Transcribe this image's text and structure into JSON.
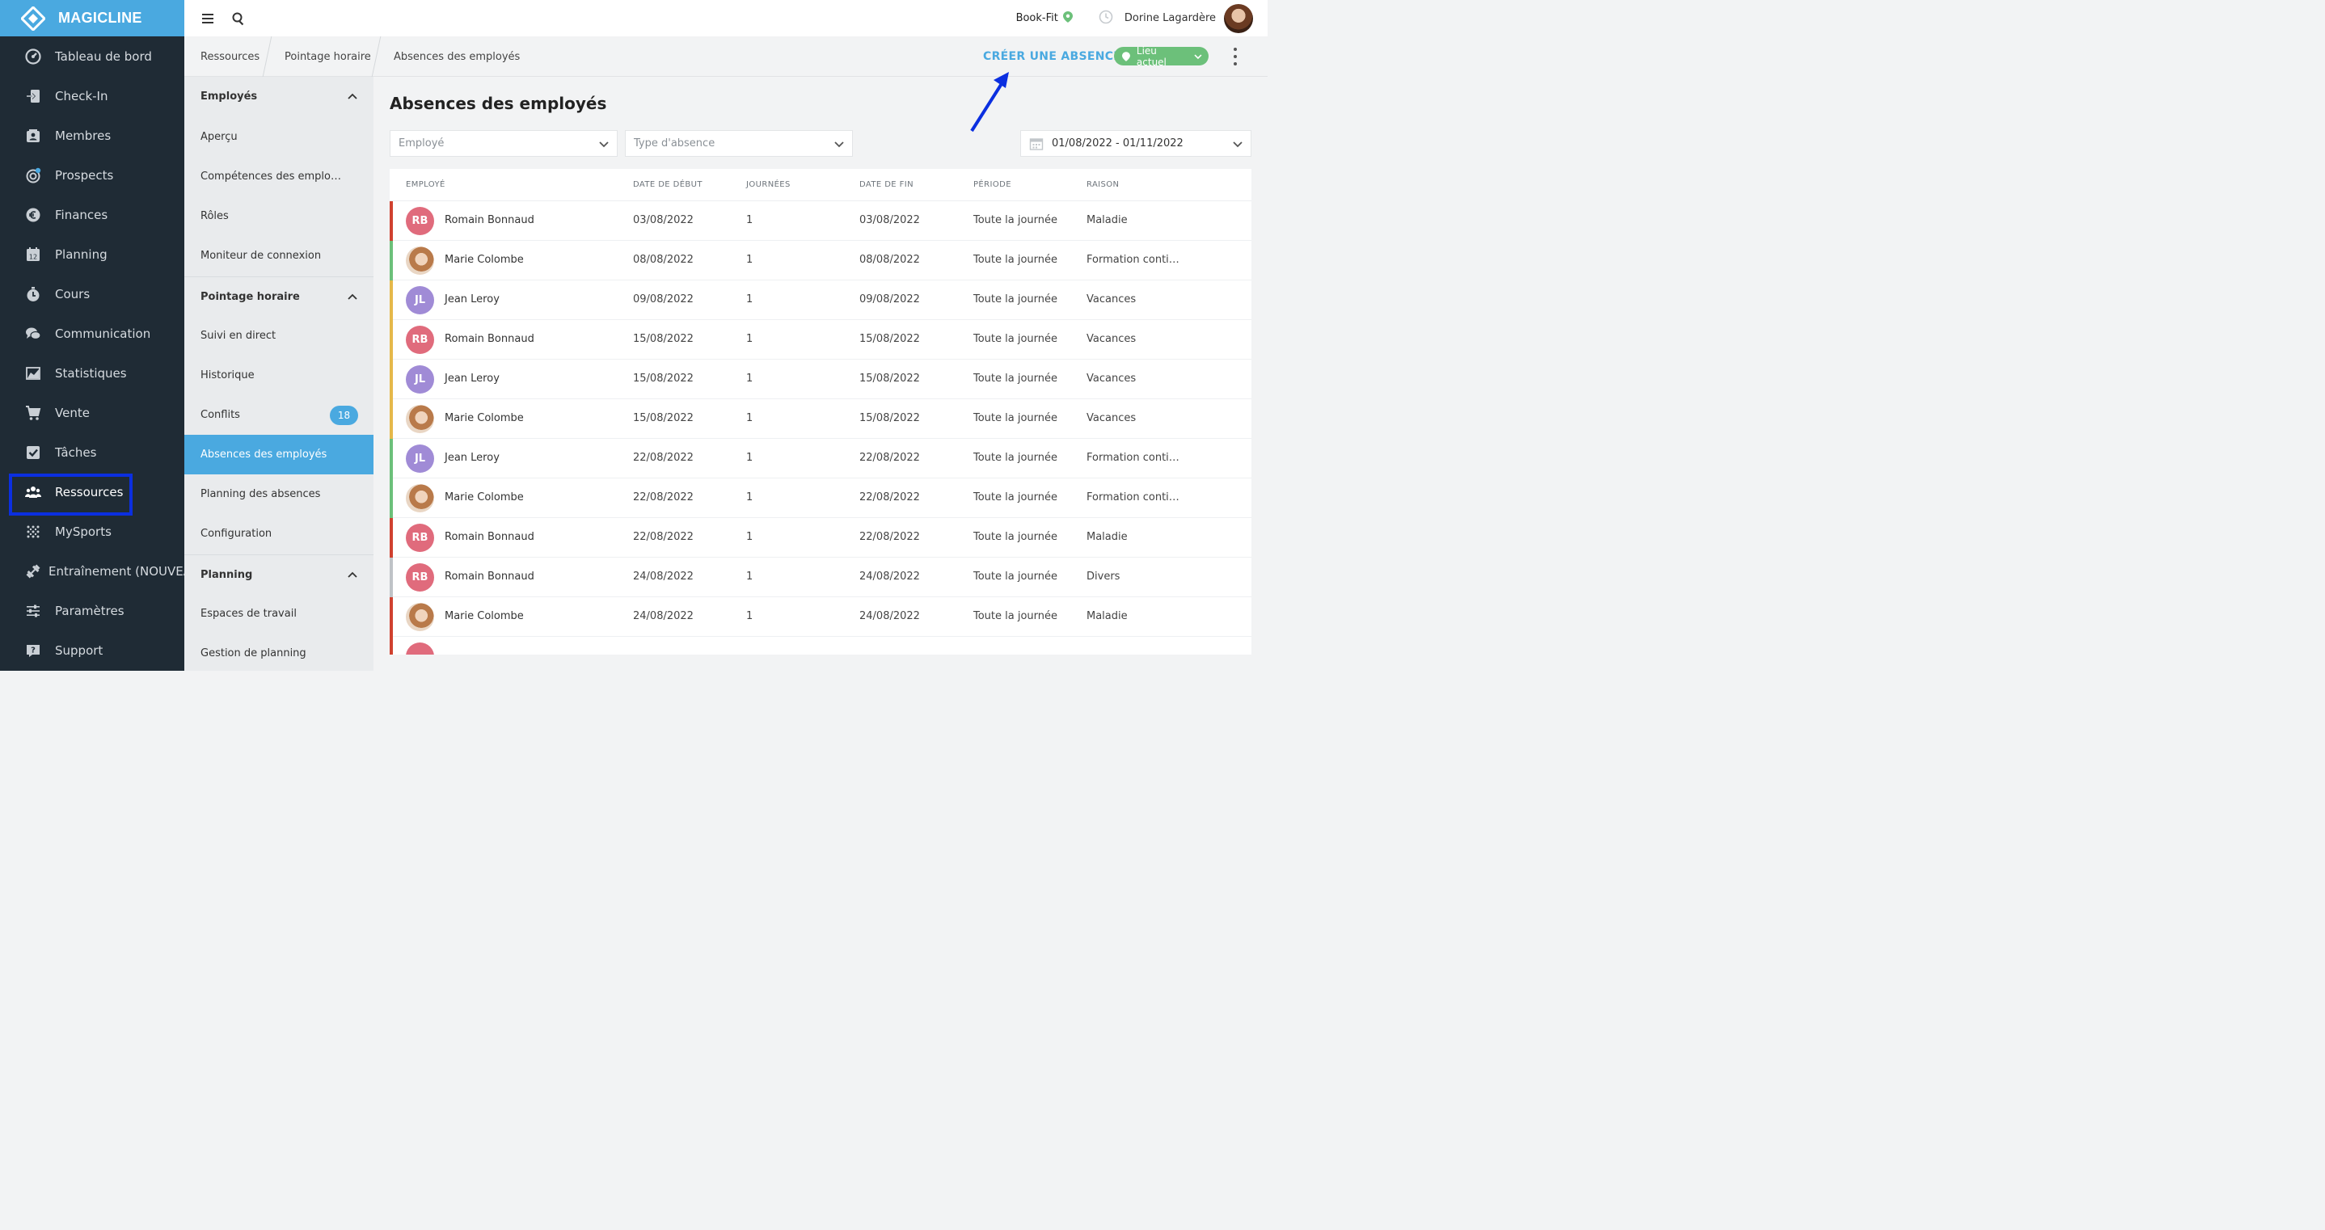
{
  "brand": {
    "name": "MAGICLINE"
  },
  "nav": {
    "items": [
      {
        "label": "Tableau de bord",
        "icon": "dashboard-icon"
      },
      {
        "label": "Check-In",
        "icon": "check-in-icon"
      },
      {
        "label": "Membres",
        "icon": "members-icon"
      },
      {
        "label": "Prospects",
        "icon": "prospects-icon"
      },
      {
        "label": "Finances",
        "icon": "euro-icon"
      },
      {
        "label": "Planning",
        "icon": "calendar-icon"
      },
      {
        "label": "Cours",
        "icon": "stopwatch-icon"
      },
      {
        "label": "Communication",
        "icon": "chat-icon"
      },
      {
        "label": "Statistiques",
        "icon": "chart-icon"
      },
      {
        "label": "Vente",
        "icon": "cart-icon"
      },
      {
        "label": "Tâches",
        "icon": "checkbox-icon"
      },
      {
        "label": "Ressources",
        "icon": "people-icon"
      },
      {
        "label": "MySports",
        "icon": "dots-grid-icon"
      },
      {
        "label": "Entraînement (NOUVEAU)",
        "icon": "dumbbell-icon"
      },
      {
        "label": "Paramètres",
        "icon": "sliders-icon"
      },
      {
        "label": "Support",
        "icon": "help-icon"
      }
    ],
    "active_index": 11
  },
  "topbar": {
    "studio": "Book-Fit",
    "user": "Dorine Lagardère"
  },
  "breadcrumb": [
    "Ressources",
    "Pointage horaire",
    "Absences des employés"
  ],
  "actions": {
    "create": "CRÉER UNE ABSENCE",
    "location": "Lieu actuel"
  },
  "subnav": {
    "sections": [
      {
        "title": "Employés",
        "items": [
          "Aperçu",
          "Compétences des emplo…",
          "Rôles",
          "Moniteur de connexion"
        ]
      },
      {
        "title": "Pointage horaire",
        "items": [
          "Suivi en direct",
          "Historique",
          "Conflits",
          "Absences des employés",
          "Planning des absences",
          "Configuration"
        ]
      },
      {
        "title": "Planning",
        "items": [
          "Espaces de travail",
          "Gestion de planning"
        ]
      }
    ],
    "conflicts_badge": "18"
  },
  "page": {
    "title": "Absences des employés"
  },
  "filters": {
    "employee_placeholder": "Employé",
    "type_placeholder": "Type d'absence",
    "date_range": "01/08/2022 - 01/11/2022"
  },
  "table": {
    "headers": [
      "EMPLOYÉ",
      "DATE DE DÉBUT",
      "JOURNÉES",
      "DATE DE FIN",
      "PÉRIODE",
      "RAISON"
    ],
    "rows": [
      {
        "initials": "RB",
        "name": "Romain Bonnaud",
        "start": "03/08/2022",
        "days": "1",
        "end": "03/08/2022",
        "period": "Toute la journée",
        "reason": "Maladie",
        "bar": "#d0412f",
        "avatar": "#e06b7c"
      },
      {
        "initials": "",
        "name": "Marie Colombe",
        "start": "08/08/2022",
        "days": "1",
        "end": "08/08/2022",
        "period": "Toute la journée",
        "reason": "Formation conti…",
        "bar": "#6cc07a",
        "avatar": "photo"
      },
      {
        "initials": "JL",
        "name": "Jean Leroy",
        "start": "09/08/2022",
        "days": "1",
        "end": "09/08/2022",
        "period": "Toute la journée",
        "reason": "Vacances",
        "bar": "#e5b84a",
        "avatar": "#a08bd6"
      },
      {
        "initials": "RB",
        "name": "Romain Bonnaud",
        "start": "15/08/2022",
        "days": "1",
        "end": "15/08/2022",
        "period": "Toute la journée",
        "reason": "Vacances",
        "bar": "#e5b84a",
        "avatar": "#e06b7c"
      },
      {
        "initials": "JL",
        "name": "Jean Leroy",
        "start": "15/08/2022",
        "days": "1",
        "end": "15/08/2022",
        "period": "Toute la journée",
        "reason": "Vacances",
        "bar": "#e5b84a",
        "avatar": "#a08bd6"
      },
      {
        "initials": "",
        "name": "Marie Colombe",
        "start": "15/08/2022",
        "days": "1",
        "end": "15/08/2022",
        "period": "Toute la journée",
        "reason": "Vacances",
        "bar": "#e5b84a",
        "avatar": "photo"
      },
      {
        "initials": "JL",
        "name": "Jean Leroy",
        "start": "22/08/2022",
        "days": "1",
        "end": "22/08/2022",
        "period": "Toute la journée",
        "reason": "Formation conti…",
        "bar": "#6cc07a",
        "avatar": "#a08bd6"
      },
      {
        "initials": "",
        "name": "Marie Colombe",
        "start": "22/08/2022",
        "days": "1",
        "end": "22/08/2022",
        "period": "Toute la journée",
        "reason": "Formation conti…",
        "bar": "#6cc07a",
        "avatar": "photo"
      },
      {
        "initials": "RB",
        "name": "Romain Bonnaud",
        "start": "22/08/2022",
        "days": "1",
        "end": "22/08/2022",
        "period": "Toute la journée",
        "reason": "Maladie",
        "bar": "#d0412f",
        "avatar": "#e06b7c"
      },
      {
        "initials": "RB",
        "name": "Romain Bonnaud",
        "start": "24/08/2022",
        "days": "1",
        "end": "24/08/2022",
        "period": "Toute la journée",
        "reason": "Divers",
        "bar": "#bfc3c7",
        "avatar": "#e06b7c"
      },
      {
        "initials": "",
        "name": "Marie Colombe",
        "start": "24/08/2022",
        "days": "1",
        "end": "24/08/2022",
        "period": "Toute la journée",
        "reason": "Maladie",
        "bar": "#d0412f",
        "avatar": "photo"
      },
      {
        "initials": "",
        "name": "",
        "start": "",
        "days": "",
        "end": "",
        "period": "",
        "reason": "",
        "bar": "#d0412f",
        "avatar": "#e06b7c"
      }
    ]
  },
  "colors": {
    "accent": "#4aa9e0",
    "nav_bg": "#1f2b35",
    "green": "#6cc07a",
    "annotation": "#0b2fe0"
  }
}
